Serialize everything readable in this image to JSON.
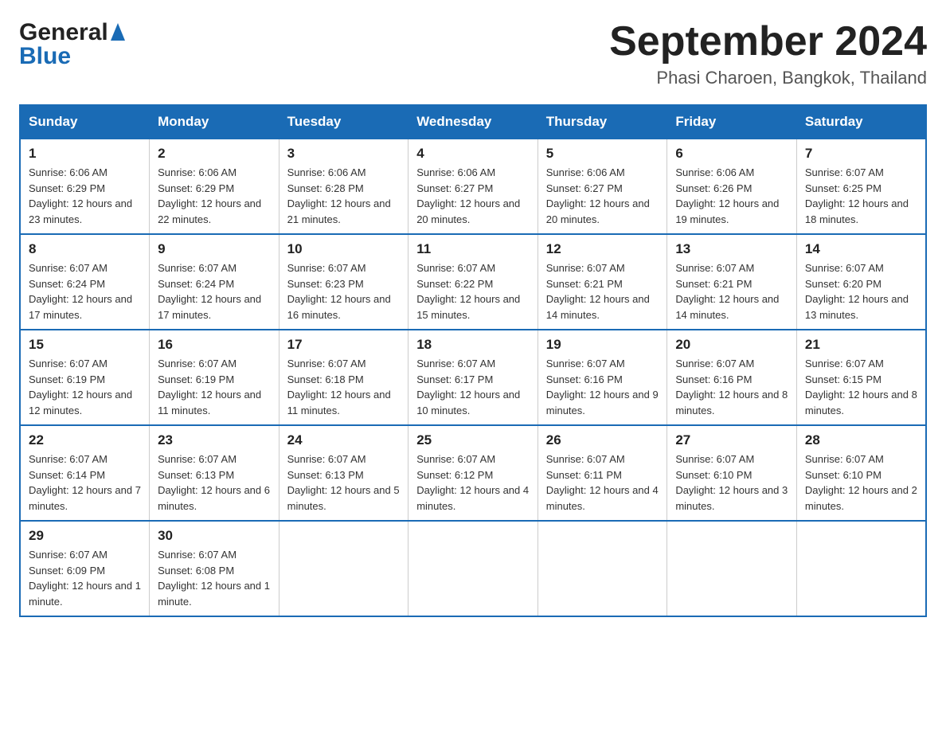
{
  "header": {
    "logo_general": "General",
    "logo_blue": "Blue",
    "month_title": "September 2024",
    "subtitle": "Phasi Charoen, Bangkok, Thailand"
  },
  "weekdays": [
    "Sunday",
    "Monday",
    "Tuesday",
    "Wednesday",
    "Thursday",
    "Friday",
    "Saturday"
  ],
  "weeks": [
    [
      {
        "day": "1",
        "sunrise": "Sunrise: 6:06 AM",
        "sunset": "Sunset: 6:29 PM",
        "daylight": "Daylight: 12 hours and 23 minutes."
      },
      {
        "day": "2",
        "sunrise": "Sunrise: 6:06 AM",
        "sunset": "Sunset: 6:29 PM",
        "daylight": "Daylight: 12 hours and 22 minutes."
      },
      {
        "day": "3",
        "sunrise": "Sunrise: 6:06 AM",
        "sunset": "Sunset: 6:28 PM",
        "daylight": "Daylight: 12 hours and 21 minutes."
      },
      {
        "day": "4",
        "sunrise": "Sunrise: 6:06 AM",
        "sunset": "Sunset: 6:27 PM",
        "daylight": "Daylight: 12 hours and 20 minutes."
      },
      {
        "day": "5",
        "sunrise": "Sunrise: 6:06 AM",
        "sunset": "Sunset: 6:27 PM",
        "daylight": "Daylight: 12 hours and 20 minutes."
      },
      {
        "day": "6",
        "sunrise": "Sunrise: 6:06 AM",
        "sunset": "Sunset: 6:26 PM",
        "daylight": "Daylight: 12 hours and 19 minutes."
      },
      {
        "day": "7",
        "sunrise": "Sunrise: 6:07 AM",
        "sunset": "Sunset: 6:25 PM",
        "daylight": "Daylight: 12 hours and 18 minutes."
      }
    ],
    [
      {
        "day": "8",
        "sunrise": "Sunrise: 6:07 AM",
        "sunset": "Sunset: 6:24 PM",
        "daylight": "Daylight: 12 hours and 17 minutes."
      },
      {
        "day": "9",
        "sunrise": "Sunrise: 6:07 AM",
        "sunset": "Sunset: 6:24 PM",
        "daylight": "Daylight: 12 hours and 17 minutes."
      },
      {
        "day": "10",
        "sunrise": "Sunrise: 6:07 AM",
        "sunset": "Sunset: 6:23 PM",
        "daylight": "Daylight: 12 hours and 16 minutes."
      },
      {
        "day": "11",
        "sunrise": "Sunrise: 6:07 AM",
        "sunset": "Sunset: 6:22 PM",
        "daylight": "Daylight: 12 hours and 15 minutes."
      },
      {
        "day": "12",
        "sunrise": "Sunrise: 6:07 AM",
        "sunset": "Sunset: 6:21 PM",
        "daylight": "Daylight: 12 hours and 14 minutes."
      },
      {
        "day": "13",
        "sunrise": "Sunrise: 6:07 AM",
        "sunset": "Sunset: 6:21 PM",
        "daylight": "Daylight: 12 hours and 14 minutes."
      },
      {
        "day": "14",
        "sunrise": "Sunrise: 6:07 AM",
        "sunset": "Sunset: 6:20 PM",
        "daylight": "Daylight: 12 hours and 13 minutes."
      }
    ],
    [
      {
        "day": "15",
        "sunrise": "Sunrise: 6:07 AM",
        "sunset": "Sunset: 6:19 PM",
        "daylight": "Daylight: 12 hours and 12 minutes."
      },
      {
        "day": "16",
        "sunrise": "Sunrise: 6:07 AM",
        "sunset": "Sunset: 6:19 PM",
        "daylight": "Daylight: 12 hours and 11 minutes."
      },
      {
        "day": "17",
        "sunrise": "Sunrise: 6:07 AM",
        "sunset": "Sunset: 6:18 PM",
        "daylight": "Daylight: 12 hours and 11 minutes."
      },
      {
        "day": "18",
        "sunrise": "Sunrise: 6:07 AM",
        "sunset": "Sunset: 6:17 PM",
        "daylight": "Daylight: 12 hours and 10 minutes."
      },
      {
        "day": "19",
        "sunrise": "Sunrise: 6:07 AM",
        "sunset": "Sunset: 6:16 PM",
        "daylight": "Daylight: 12 hours and 9 minutes."
      },
      {
        "day": "20",
        "sunrise": "Sunrise: 6:07 AM",
        "sunset": "Sunset: 6:16 PM",
        "daylight": "Daylight: 12 hours and 8 minutes."
      },
      {
        "day": "21",
        "sunrise": "Sunrise: 6:07 AM",
        "sunset": "Sunset: 6:15 PM",
        "daylight": "Daylight: 12 hours and 8 minutes."
      }
    ],
    [
      {
        "day": "22",
        "sunrise": "Sunrise: 6:07 AM",
        "sunset": "Sunset: 6:14 PM",
        "daylight": "Daylight: 12 hours and 7 minutes."
      },
      {
        "day": "23",
        "sunrise": "Sunrise: 6:07 AM",
        "sunset": "Sunset: 6:13 PM",
        "daylight": "Daylight: 12 hours and 6 minutes."
      },
      {
        "day": "24",
        "sunrise": "Sunrise: 6:07 AM",
        "sunset": "Sunset: 6:13 PM",
        "daylight": "Daylight: 12 hours and 5 minutes."
      },
      {
        "day": "25",
        "sunrise": "Sunrise: 6:07 AM",
        "sunset": "Sunset: 6:12 PM",
        "daylight": "Daylight: 12 hours and 4 minutes."
      },
      {
        "day": "26",
        "sunrise": "Sunrise: 6:07 AM",
        "sunset": "Sunset: 6:11 PM",
        "daylight": "Daylight: 12 hours and 4 minutes."
      },
      {
        "day": "27",
        "sunrise": "Sunrise: 6:07 AM",
        "sunset": "Sunset: 6:10 PM",
        "daylight": "Daylight: 12 hours and 3 minutes."
      },
      {
        "day": "28",
        "sunrise": "Sunrise: 6:07 AM",
        "sunset": "Sunset: 6:10 PM",
        "daylight": "Daylight: 12 hours and 2 minutes."
      }
    ],
    [
      {
        "day": "29",
        "sunrise": "Sunrise: 6:07 AM",
        "sunset": "Sunset: 6:09 PM",
        "daylight": "Daylight: 12 hours and 1 minute."
      },
      {
        "day": "30",
        "sunrise": "Sunrise: 6:07 AM",
        "sunset": "Sunset: 6:08 PM",
        "daylight": "Daylight: 12 hours and 1 minute."
      },
      null,
      null,
      null,
      null,
      null
    ]
  ]
}
